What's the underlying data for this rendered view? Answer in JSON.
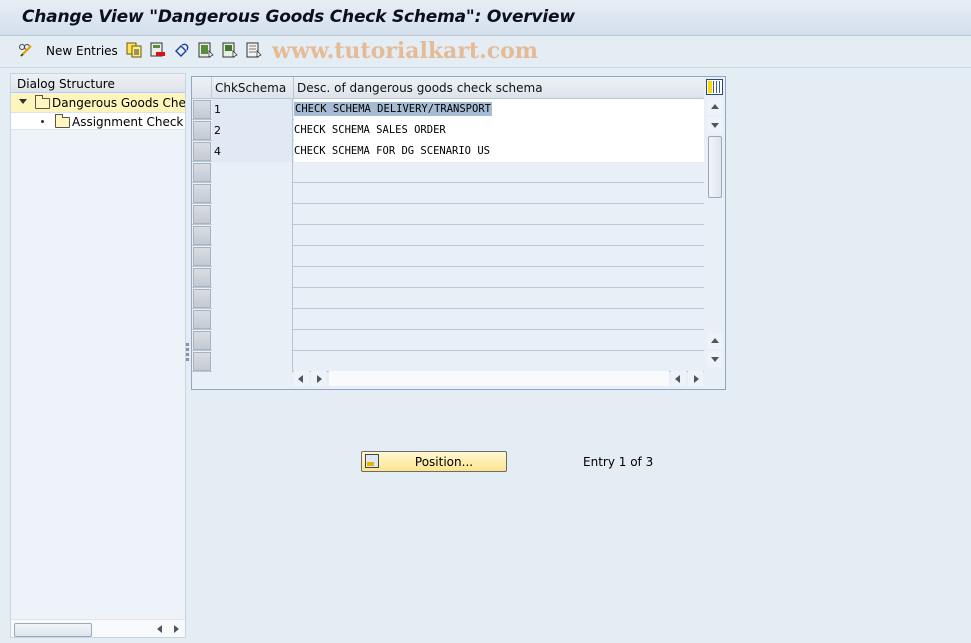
{
  "window": {
    "title": "Change View \"Dangerous Goods Check Schema\": Overview"
  },
  "toolbar": {
    "new_entries_label": "New Entries",
    "icons": [
      "edit-glasses-icon",
      "copy-icon",
      "delete-icon",
      "undo-icon",
      "select-all-icon",
      "select-block-icon",
      "deselect-all-icon"
    ],
    "watermark": "www.tutorialkart.com"
  },
  "dialog_structure": {
    "header": "Dialog Structure",
    "items": [
      {
        "label": "Dangerous Goods Check Schema",
        "selected": true,
        "expanded": true
      },
      {
        "label": "Assignment Check Schema",
        "selected": false,
        "level": 2
      }
    ]
  },
  "table": {
    "columns": [
      "ChkSchema",
      "Desc. of dangerous goods check schema"
    ],
    "rows": [
      {
        "schema": "1",
        "description": "CHECK SCHEMA DELIVERY/TRANSPORT",
        "highlighted": true
      },
      {
        "schema": "2",
        "description": "CHECK SCHEMA SALES ORDER",
        "highlighted": false
      },
      {
        "schema": "4",
        "description": "CHECK SCHEMA FOR DG SCENARIO US",
        "highlighted": false
      }
    ],
    "empty_rows": 10
  },
  "footer": {
    "position_label": "Position...",
    "entry_info": "Entry 1 of 3"
  }
}
